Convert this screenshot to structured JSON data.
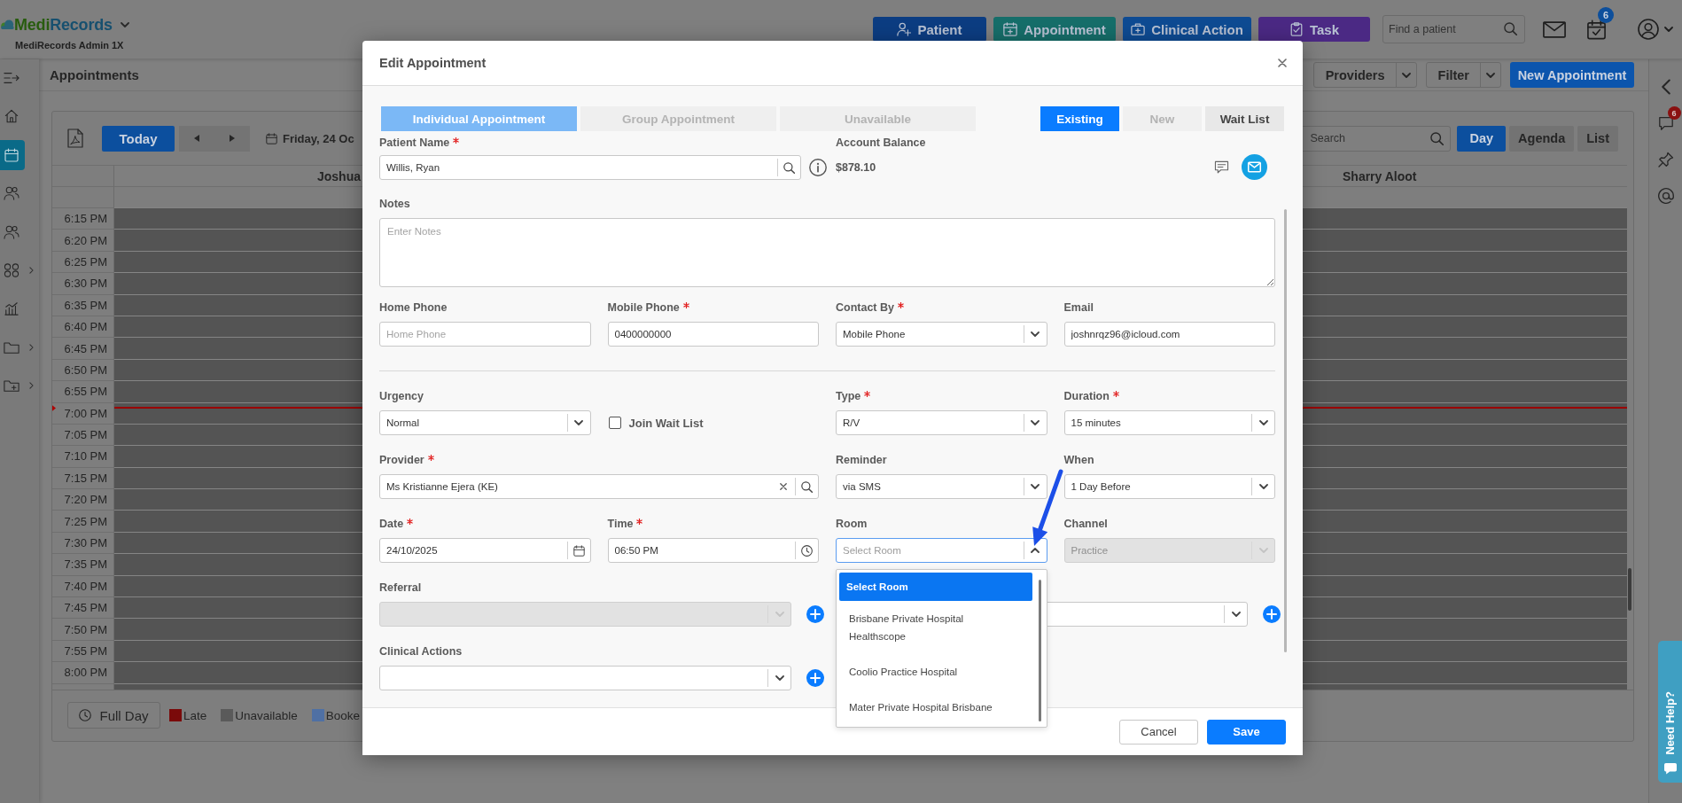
{
  "header": {
    "logo": "MediRecords",
    "account": "MediRecords Admin 1X",
    "actions": [
      {
        "label": "Patient",
        "kind": "patient",
        "color": "#0c3d82"
      },
      {
        "label": "Appointment",
        "kind": "appointment",
        "color": "#166e6a"
      },
      {
        "label": "Clinical Action",
        "kind": "clinical",
        "color": "#0e4b93"
      },
      {
        "label": "Task",
        "kind": "task",
        "color": "#4b2984"
      }
    ],
    "search": {
      "placeholder": "Find a patient"
    },
    "tasks_badge": "6"
  },
  "sidebar": {
    "items": [
      {
        "kind": "collapse",
        "selected": false,
        "expandable": false
      },
      {
        "kind": "home",
        "selected": false,
        "expandable": false
      },
      {
        "kind": "calendar",
        "selected": true,
        "expandable": false
      },
      {
        "kind": "patients",
        "selected": false,
        "expandable": false
      },
      {
        "kind": "contacts",
        "selected": false,
        "expandable": false
      },
      {
        "kind": "apps",
        "selected": false,
        "expandable": true
      },
      {
        "kind": "reports",
        "selected": false,
        "expandable": false
      },
      {
        "kind": "folder",
        "selected": false,
        "expandable": true
      },
      {
        "kind": "new-folder",
        "selected": false,
        "expandable": true
      }
    ]
  },
  "page": {
    "title": "Appointments",
    "buttons": [
      {
        "label": "Providers",
        "kind": "split"
      },
      {
        "label": "Filter",
        "kind": "split"
      },
      {
        "label": "New Appointment",
        "kind": "primary"
      }
    ]
  },
  "calendar": {
    "today": "Today",
    "date": "Friday, 24 Oc",
    "search": {
      "placeholder": "Search"
    },
    "views": [
      {
        "label": "Day",
        "selected": true
      },
      {
        "label": "Agenda",
        "selected": false
      },
      {
        "label": "List",
        "selected": false
      }
    ],
    "providers": [
      "Joshua",
      "Sharry Aloot"
    ],
    "times": [
      {
        "label": "6:15 PM",
        "now": false
      },
      {
        "label": "6:20 PM",
        "now": false
      },
      {
        "label": "6:25 PM",
        "now": false
      },
      {
        "label": "6:30 PM",
        "now": false
      },
      {
        "label": "6:35 PM",
        "now": false
      },
      {
        "label": "6:40 PM",
        "now": false
      },
      {
        "label": "6:45 PM",
        "now": false
      },
      {
        "label": "6:50 PM",
        "now": false
      },
      {
        "label": "6:55 PM",
        "now": false
      },
      {
        "label": "7:00 PM",
        "now": true
      },
      {
        "label": "7:05 PM",
        "now": false
      },
      {
        "label": "7:10 PM",
        "now": false
      },
      {
        "label": "7:15 PM",
        "now": false
      },
      {
        "label": "7:20 PM",
        "now": false
      },
      {
        "label": "7:25 PM",
        "now": false
      },
      {
        "label": "7:30 PM",
        "now": false
      },
      {
        "label": "7:35 PM",
        "now": false
      },
      {
        "label": "7:40 PM",
        "now": false
      },
      {
        "label": "7:45 PM",
        "now": false
      },
      {
        "label": "7:50 PM",
        "now": false
      },
      {
        "label": "7:55 PM",
        "now": false
      },
      {
        "label": "8:00 PM",
        "now": false
      }
    ],
    "full_day": "Full Day",
    "legend": [
      {
        "label": "Late",
        "color": "#7a0a0a"
      },
      {
        "label": "Unavailable",
        "color": "#5a5a5a"
      },
      {
        "label": "Booke",
        "color": "#4f70a4"
      }
    ]
  },
  "right_rail": {
    "items": [
      {
        "kind": "collapse"
      },
      {
        "kind": "chat",
        "badge": "6"
      },
      {
        "kind": "pin"
      },
      {
        "kind": "mention"
      }
    ],
    "help": "Need Help?"
  },
  "modal": {
    "title": "Edit Appointment",
    "appointment_types": [
      {
        "label": "Individual Appointment",
        "selected": true
      },
      {
        "label": "Group Appointment",
        "selected": false
      },
      {
        "label": "Unavailable",
        "selected": false
      }
    ],
    "patient_modes": [
      {
        "label": "Existing",
        "selected": true,
        "disabled": false
      },
      {
        "label": "New",
        "selected": false,
        "disabled": true
      },
      {
        "label": "Wait List",
        "selected": false,
        "disabled": false
      }
    ],
    "patient": {
      "label": "Patient Name",
      "required": true,
      "value": "Willis, Ryan"
    },
    "account_balance": {
      "label": "Account Balance",
      "value": "$878.10"
    },
    "notes": {
      "label": "Notes",
      "placeholder": "Enter Notes"
    },
    "contact_fields": [
      {
        "kind": "text",
        "label": "Home Phone",
        "required": false,
        "placeholder": "Home Phone"
      },
      {
        "kind": "text",
        "label": "Mobile Phone",
        "required": true,
        "value": "0400000000"
      },
      {
        "kind": "select",
        "label": "Contact By",
        "required": true,
        "value": "Mobile Phone",
        "open": false,
        "disabled": false
      },
      {
        "kind": "text",
        "label": "Email",
        "required": false,
        "value": "joshnrqz96@icloud.com"
      }
    ],
    "appointment_fields": [
      {
        "kind": "select",
        "label": "Urgency",
        "required": false,
        "value": "Normal",
        "open": false,
        "disabled": false
      },
      {
        "kind": "checkbox",
        "label": "Join Wait List",
        "checked": false,
        "disabled": false
      },
      {
        "kind": "select",
        "label": "Type",
        "required": true,
        "value": "R/V",
        "open": false,
        "disabled": false
      },
      {
        "kind": "select",
        "label": "Duration",
        "required": true,
        "value": "15 minutes",
        "open": false,
        "disabled": false
      },
      {
        "kind": "provider",
        "label": "Provider",
        "required": true,
        "value": "Ms Kristianne Ejera (KE)",
        "disabled": false
      },
      {
        "kind": "select",
        "label": "Reminder",
        "required": false,
        "value": "via SMS",
        "open": false,
        "disabled": false
      },
      {
        "kind": "select",
        "label": "When",
        "required": false,
        "value": "1 Day Before",
        "open": false,
        "disabled": false
      },
      {
        "kind": "date",
        "label": "Date",
        "required": true,
        "value": "24/10/2025",
        "disabled": false
      },
      {
        "kind": "time",
        "label": "Time",
        "required": true,
        "value": "06:50 PM",
        "disabled": false
      },
      {
        "kind": "select",
        "label": "Room",
        "required": false,
        "placeholder": "Select Room",
        "open": true,
        "disabled": false,
        "options": [
          {
            "label": "Select Room",
            "selected": true
          },
          {
            "label": "Brisbane Private Hospital Healthscope",
            "selected": false
          },
          {
            "label": "Coolio Practice Hospital",
            "selected": false
          },
          {
            "label": "Mater Private Hospital Brisbane",
            "selected": false
          }
        ]
      },
      {
        "kind": "select",
        "label": "Channel",
        "required": false,
        "value": "Practice",
        "open": false,
        "disabled": true
      },
      {
        "kind": "add-select",
        "label": "Referral",
        "required": false,
        "open": false,
        "disabled": true
      },
      {
        "kind": "add-select",
        "open": false,
        "disabled": false
      },
      {
        "kind": "add-select",
        "label": "Clinical Actions",
        "required": false,
        "open": false,
        "disabled": false
      }
    ],
    "buttons": [
      {
        "label": "Cancel",
        "kind": "secondary"
      },
      {
        "label": "Save",
        "kind": "primary"
      }
    ]
  },
  "annotation": {
    "kind": "arrow"
  }
}
